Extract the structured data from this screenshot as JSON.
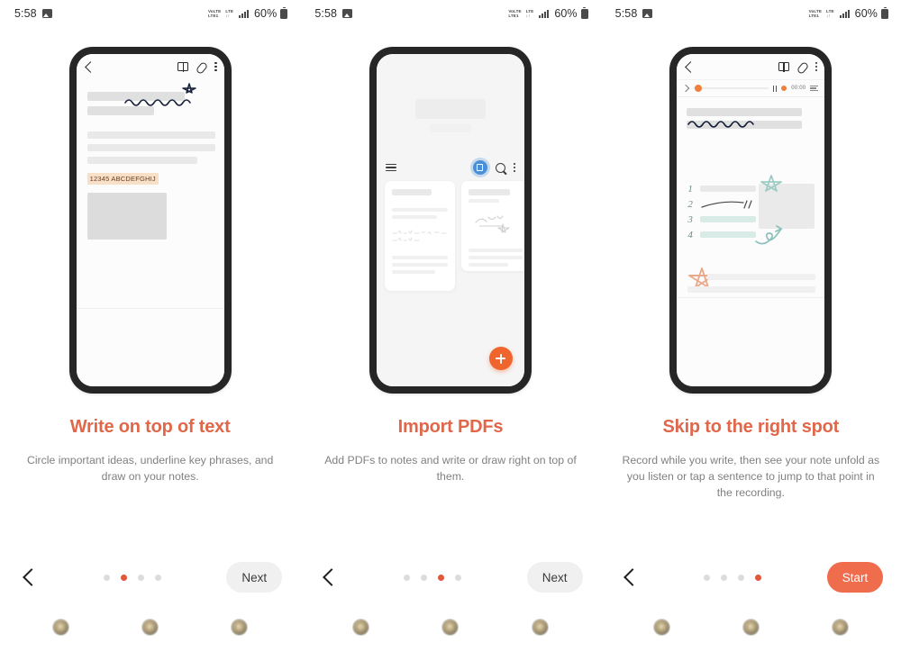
{
  "statusbar": {
    "time": "5:58",
    "photo_icon": "photo-icon",
    "volte_line1": "VoLTE",
    "volte_line2": "LTE1",
    "network_label": "LTE",
    "battery": "60%"
  },
  "panels": [
    {
      "id": "write-on-top-of-text",
      "headline": "Write on top of text",
      "subtext": "Circle important ideas, underline key phrases, and draw on your notes.",
      "phone": {
        "type": "note-editor",
        "toolbar": {
          "back_icon": "back-chevron-icon",
          "book_icon": "book-view-icon",
          "attach_icon": "paperclip-icon",
          "more_icon": "more-vertical-icon"
        },
        "highlighted_text": "12345  ABCDEFGHIJ",
        "ink": [
          "squiggle-underline",
          "hand-drawn-star"
        ]
      },
      "footer": {
        "back_icon": "back-chevron-icon",
        "dots": 4,
        "active_dot": 1,
        "cta_label": "Next",
        "cta_style": "ghost"
      }
    },
    {
      "id": "import-pdfs",
      "headline": "Import PDFs",
      "subtext": "Add PDFs to notes and write or draw right on top of them.",
      "phone": {
        "type": "notes-list",
        "toolbar": {
          "menu_icon": "hamburger-menu-icon",
          "pdf_icon": "import-pdf-icon",
          "search_icon": "search-icon",
          "more_icon": "more-vertical-icon"
        },
        "fab_icon": "add-note-fab-icon",
        "cards": 2
      },
      "footer": {
        "back_icon": "back-chevron-icon",
        "dots": 4,
        "active_dot": 2,
        "cta_label": "Next",
        "cta_style": "ghost"
      }
    },
    {
      "id": "skip-to-the-right-spot",
      "headline": "Skip to the right spot",
      "subtext": "Record while you write, then see your note unfold as you listen or tap a sentence to jump to that point in the recording.",
      "phone": {
        "type": "note-with-audio",
        "toolbar": {
          "back_icon": "back-chevron-icon",
          "book_icon": "book-view-icon",
          "attach_icon": "paperclip-icon",
          "more_icon": "more-vertical-icon"
        },
        "player": {
          "expand_icon": "chevron-right-icon",
          "pause_icon": "pause-icon",
          "record_icon": "record-dot-icon",
          "elapsed": "00:00",
          "list_icon": "playlist-icon"
        },
        "list_numbers": [
          "1",
          "2",
          "3",
          "4"
        ],
        "ink": [
          "squiggle-underline",
          "teal-star",
          "teal-arrow",
          "orange-star"
        ]
      },
      "footer": {
        "back_icon": "back-chevron-icon",
        "dots": 4,
        "active_dot": 3,
        "cta_label": "Start",
        "cta_style": "solid"
      }
    }
  ],
  "colors": {
    "accent": "#e0674a",
    "cta_solid": "#ef6c4d",
    "highlight": "#f7dfc8",
    "fab": "#f0652e",
    "pdf_badge": "#4a90d9",
    "teal": "#d8ebe6"
  },
  "badges": {
    "icon": "seal-badge-icon",
    "count_per_panel": 3
  }
}
